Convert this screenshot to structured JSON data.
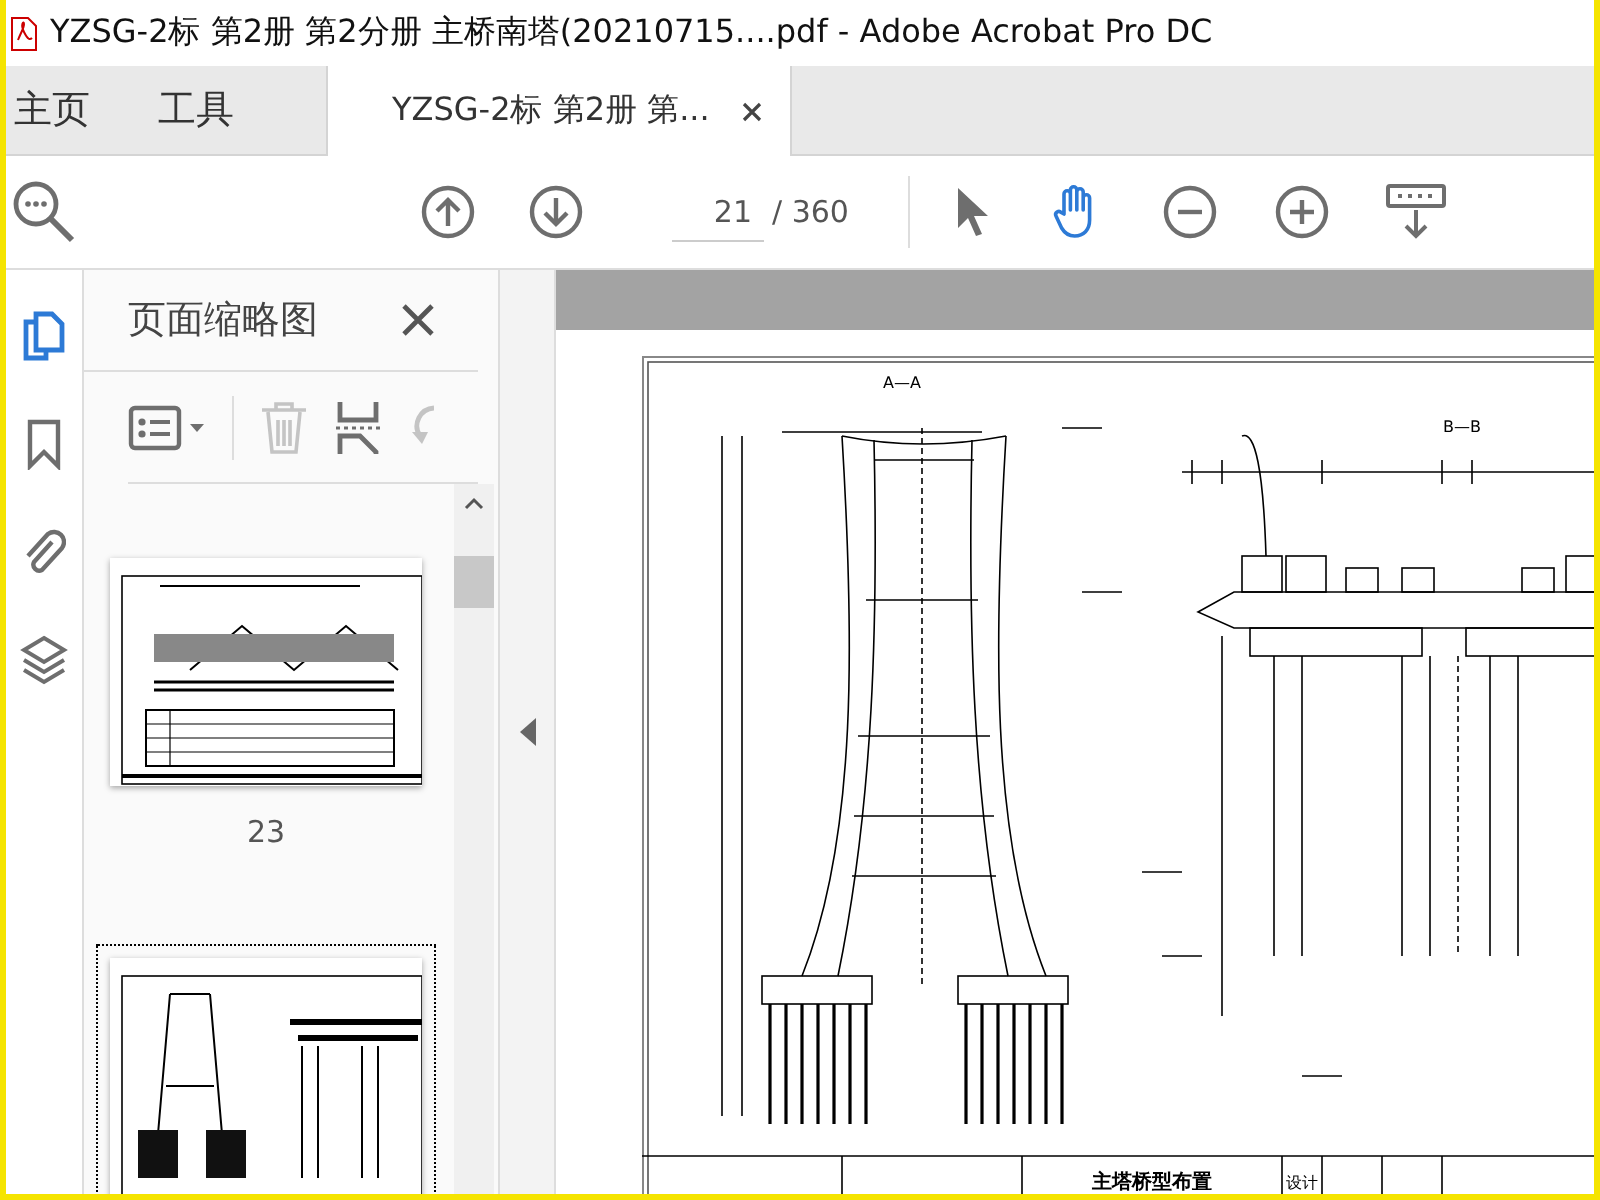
{
  "window": {
    "title": "YZSG-2标 第2册 第2分册 主桥南塔(20210715....pdf - Adobe Acrobat Pro DC"
  },
  "tabs": [
    {
      "label": "主页",
      "selected": false,
      "kind": "nav"
    },
    {
      "label": "工具",
      "selected": false,
      "kind": "nav"
    },
    {
      "label": "YZSG-2标 第2册 第...",
      "selected": true,
      "kind": "document"
    }
  ],
  "toolbar": {
    "page_field": {
      "value": "21"
    },
    "page_total": "/ 360",
    "tools": [
      {
        "kind": "select",
        "selected": false
      },
      {
        "kind": "hand",
        "selected": true
      }
    ]
  },
  "rail": [
    {
      "kind": "pages",
      "selected": true
    },
    {
      "kind": "bookmarks",
      "selected": false
    },
    {
      "kind": "attachments",
      "selected": false
    },
    {
      "kind": "layers",
      "selected": false
    }
  ],
  "panel": {
    "title": "页面缩略图",
    "thumbnails": [
      {
        "label": "23",
        "selected": false
      },
      {
        "selected": true
      }
    ]
  },
  "document": {
    "section_labels": [
      "A—A",
      "B—B"
    ],
    "title_block": [
      "主塔桥型布置",
      "设计"
    ]
  }
}
